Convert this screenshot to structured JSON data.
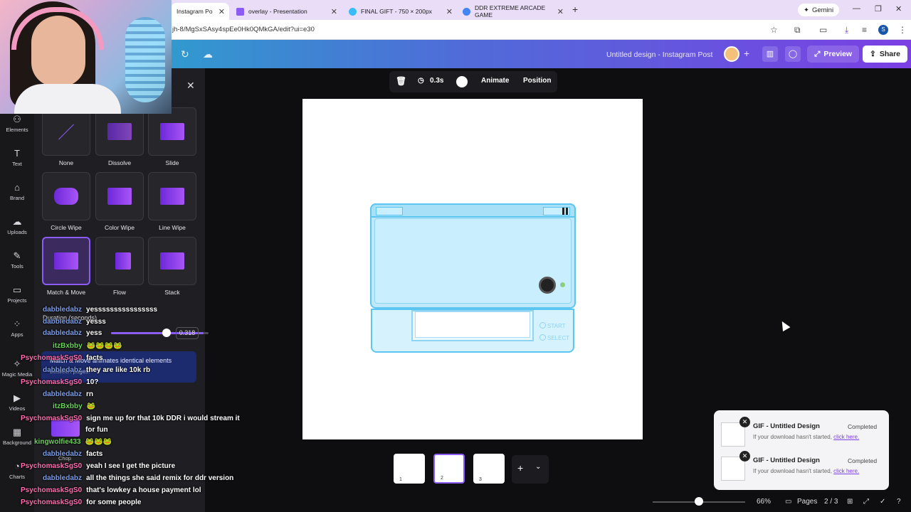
{
  "browser": {
    "tabs": [
      {
        "label": "Instagram Po",
        "color": "#ffffff"
      },
      {
        "label": "overlay - Presentation",
        "color": "#8b5cf6"
      },
      {
        "label": "FINAL GIFT - 750 × 200px",
        "color": "#38bdf8"
      },
      {
        "label": "DDR EXTREME ARCADE GAME",
        "color": "#4285f4"
      }
    ],
    "gemini_label": "Gemini",
    "url": "jh-8/MgSxSAsy4spEe0Hk0QMkGA/edit?ui=e30"
  },
  "header": {
    "design_title": "Untitled design - Instagram Post",
    "preview_label": "Preview",
    "share_label": "Share"
  },
  "rail": {
    "items": [
      {
        "label": "Elements",
        "icon": "elements-icon"
      },
      {
        "label": "Text",
        "icon": "text-icon"
      },
      {
        "label": "Brand",
        "icon": "brand-icon"
      },
      {
        "label": "Uploads",
        "icon": "uploads-icon"
      },
      {
        "label": "Tools",
        "icon": "tools-icon"
      },
      {
        "label": "Projects",
        "icon": "projects-icon"
      },
      {
        "label": "Apps",
        "icon": "apps-icon"
      },
      {
        "label": "Magic Media",
        "icon": "magic-media-icon"
      },
      {
        "label": "Videos",
        "icon": "videos-icon"
      },
      {
        "label": "Background",
        "icon": "background-icon"
      },
      {
        "label": "Charts",
        "icon": "charts-icon"
      }
    ]
  },
  "panel": {
    "effects": [
      {
        "label": "None"
      },
      {
        "label": "Dissolve"
      },
      {
        "label": "Slide"
      },
      {
        "label": "Circle Wipe"
      },
      {
        "label": "Color Wipe"
      },
      {
        "label": "Line Wipe"
      },
      {
        "label": "Match & Move",
        "selected": true
      },
      {
        "label": "Flow"
      },
      {
        "label": "Stack"
      }
    ],
    "duration_label": "Duration (seconds)",
    "duration_value": "0.318",
    "duration_fraction": 0.95,
    "info_text": "Match & Move animates identical elements",
    "info_sub": "between pages.",
    "chop_label": "Chop"
  },
  "toolbar": {
    "duration": "0.3s",
    "animate_label": "Animate",
    "position_label": "Position"
  },
  "device": {
    "start_label": "START",
    "select_label": "SELECT"
  },
  "downloads": [
    {
      "title": "GIF - Untitled Design",
      "status": "Completed",
      "note": "If your download hasn't started,",
      "link": "click here."
    },
    {
      "title": "GIF - Untitled Design",
      "status": "Completed",
      "note": "If your download hasn't started,",
      "link": "click here."
    }
  ],
  "pages": {
    "thumbs": [
      {
        "num": "1"
      },
      {
        "num": "2"
      },
      {
        "num": "3"
      }
    ],
    "zoom": "66%",
    "pages_label": "Pages",
    "page_count": "2 / 3"
  },
  "chat": [
    {
      "user": "dabbledabz",
      "msg": "yessssssssssssssss",
      "color": "#7c9ce8"
    },
    {
      "user": "dabbledabz",
      "msg": "yesss",
      "color": "#7c9ce8"
    },
    {
      "user": "dabbledabz",
      "msg": "yess",
      "color": "#7c9ce8"
    },
    {
      "user": "itzBxbby",
      "msg": "🐸🐸🐸🐸",
      "color": "#6ad35a"
    },
    {
      "user": "PsychomaskSgS0",
      "msg": "facts",
      "color": "#ff6fb0"
    },
    {
      "user": "dabbledabz",
      "msg": "they are like 10k rb",
      "color": "#7c9ce8"
    },
    {
      "user": "PsychomaskSgS0",
      "msg": "10?",
      "color": "#ff6fb0"
    },
    {
      "user": "dabbledabz",
      "msg": "rn",
      "color": "#7c9ce8"
    },
    {
      "user": "itzBxbby",
      "msg": "🐸",
      "color": "#6ad35a"
    },
    {
      "user": "PsychomaskSgS0",
      "msg": "sign me up for that 10k DDR i would stream it",
      "color": "#ff6fb0"
    },
    {
      "user": "",
      "msg": "for fun",
      "color": "#ff6fb0"
    },
    {
      "user": "kingwolfie433",
      "msg": "🐸🐸🐸",
      "color": "#6ad35a"
    },
    {
      "user": "dabbledabz",
      "msg": "facts",
      "color": "#7c9ce8"
    },
    {
      "user": "PsychomaskSgS0",
      "msg": "yeah I see I get the picture",
      "color": "#ff6fb0"
    },
    {
      "user": "dabbledabz",
      "msg": "all the things she said remix for ddr version",
      "color": "#7c9ce8"
    },
    {
      "user": "PsychomaskSgS0",
      "msg": "that's lowkey a house payment lol",
      "color": "#ff6fb0"
    },
    {
      "user": "PsychomaskSgS0",
      "msg": "for some people",
      "color": "#ff6fb0"
    }
  ]
}
